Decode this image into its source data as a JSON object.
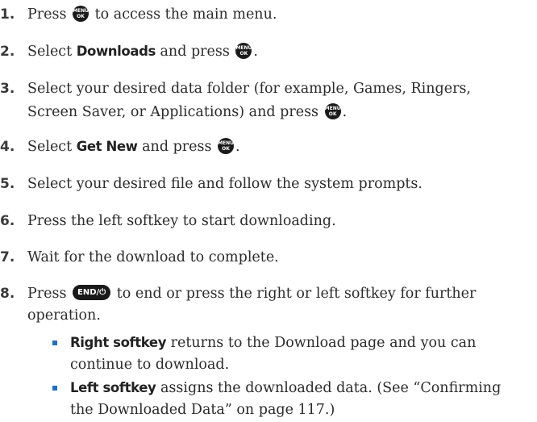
{
  "menu_key": {
    "line1": "MENU",
    "line2": "OK"
  },
  "end_key": {
    "label": "END/⏻"
  },
  "steps": [
    {
      "num": "1.",
      "before": "Press",
      "after": "to access the main menu."
    },
    {
      "num": "2.",
      "before": "Select",
      "bold": "Downloads",
      "mid": "and press",
      "after": "."
    },
    {
      "num": "3.",
      "line1": "Select your desired data folder (for example, Games, Ringers,",
      "line2_before": "Screen Saver, or Applications) and press",
      "line2_after": "."
    },
    {
      "num": "4.",
      "before": "Select",
      "bold": "Get New",
      "mid": "and press",
      "after": "."
    },
    {
      "num": "5.",
      "text": "Select your desired file and follow the system prompts."
    },
    {
      "num": "6.",
      "text": "Press the left softkey to start downloading."
    },
    {
      "num": "7.",
      "text": "Wait for the download to complete."
    },
    {
      "num": "8.",
      "before": "Press",
      "line1_after": "to end or press the right or left softkey for further",
      "line2": "operation."
    }
  ],
  "bullets": [
    {
      "bold": "Right softkey",
      "line1": "returns to the Download page and you can",
      "line2": "continue to download."
    },
    {
      "bold": "Left softkey",
      "line1": "assigns the downloaded data. (See “Confirming",
      "line2": "the Downloaded Data” on page 117.)"
    }
  ]
}
